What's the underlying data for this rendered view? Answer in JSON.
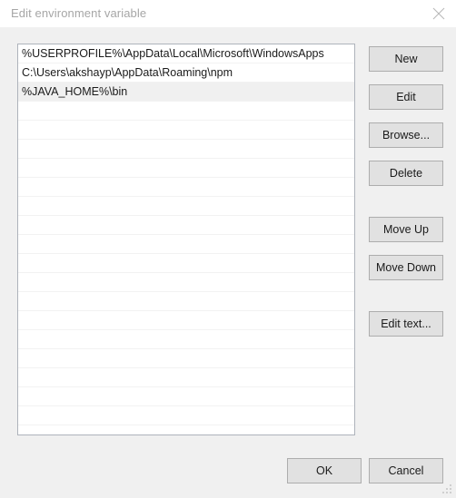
{
  "window": {
    "title": "Edit environment variable",
    "close_icon": "close-icon"
  },
  "list": {
    "visible_row_count": 20,
    "selected_index": 2,
    "items": [
      "%USERPROFILE%\\AppData\\Local\\Microsoft\\WindowsApps",
      "C:\\Users\\akshayp\\AppData\\Roaming\\npm",
      "%JAVA_HOME%\\bin"
    ]
  },
  "side_buttons": {
    "new": "New",
    "edit": "Edit",
    "browse": "Browse...",
    "delete": "Delete",
    "move_up": "Move Up",
    "move_down": "Move Down",
    "edit_text": "Edit text..."
  },
  "footer_buttons": {
    "ok": "OK",
    "cancel": "Cancel"
  },
  "colors": {
    "dialog_background": "#f0f0f0",
    "titlebar_background": "#ffffff",
    "title_text": "#a6a6a6",
    "listbox_background": "#ffffff",
    "listbox_border": "#aeb3bb",
    "row_separator": "#f2f2f2",
    "selected_row": "#f0f0f0",
    "button_face": "#e1e1e1",
    "button_border": "#adadad",
    "text": "#1a1a1a"
  }
}
